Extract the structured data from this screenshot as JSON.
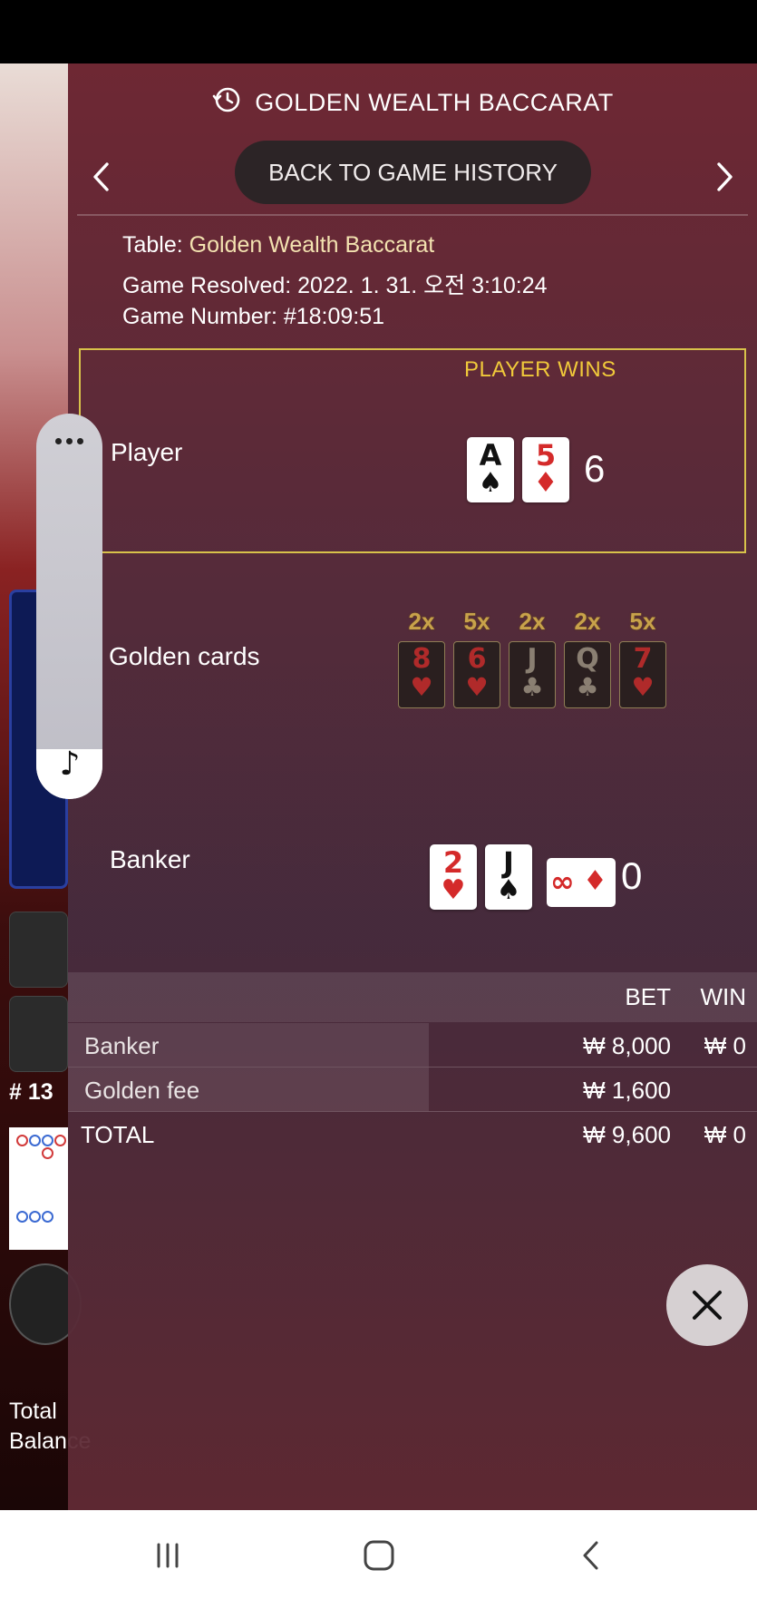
{
  "header": {
    "title": "GOLDEN WEALTH BACCARAT",
    "back_label": "BACK TO GAME HISTORY"
  },
  "info": {
    "table_label": "Table:",
    "table_value": "Golden Wealth Baccarat",
    "resolved_label": "Game Resolved:",
    "resolved_value": "2022. 1. 31. 오전 3:10:24",
    "number_label": "Game Number:",
    "number_value": "#18:09:51"
  },
  "result": {
    "outcome": "PLAYER WINS",
    "player": {
      "label": "Player",
      "cards": [
        {
          "rank": "A",
          "suit": "♠",
          "color": "black"
        },
        {
          "rank": "5",
          "suit": "♦",
          "color": "red"
        }
      ],
      "score": "6"
    },
    "golden": {
      "label": "Golden cards",
      "cards": [
        {
          "mult": "2x",
          "rank": "8",
          "suit": "♥",
          "color": "red"
        },
        {
          "mult": "5x",
          "rank": "6",
          "suit": "♥",
          "color": "red"
        },
        {
          "mult": "2x",
          "rank": "J",
          "suit": "♣",
          "color": "black"
        },
        {
          "mult": "2x",
          "rank": "Q",
          "suit": "♣",
          "color": "black"
        },
        {
          "mult": "5x",
          "rank": "7",
          "suit": "♥",
          "color": "red"
        }
      ]
    },
    "banker": {
      "label": "Banker",
      "cards": [
        {
          "rank": "2",
          "suit": "♥",
          "color": "red"
        },
        {
          "rank": "J",
          "suit": "♠",
          "color": "black"
        }
      ],
      "side_card": {
        "symbol": "∞",
        "suit": "♦"
      },
      "score": "0"
    }
  },
  "bets": {
    "col_bet": "BET",
    "col_win": "WIN",
    "rows": [
      {
        "label": "Banker",
        "bet": "₩ 8,000",
        "win": "₩ 0"
      },
      {
        "label": "Golden fee",
        "bet": "₩ 1,600",
        "win": ""
      }
    ],
    "total": {
      "label": "TOTAL",
      "bet": "₩ 9,600",
      "win": "₩ 0"
    }
  },
  "background": {
    "round_number": "# 13",
    "total_label": "Total",
    "balance_label": "Balance"
  },
  "colors": {
    "accent_gold": "#f0c93a",
    "win_border": "#d8c24a",
    "card_red": "#d42a2a"
  }
}
